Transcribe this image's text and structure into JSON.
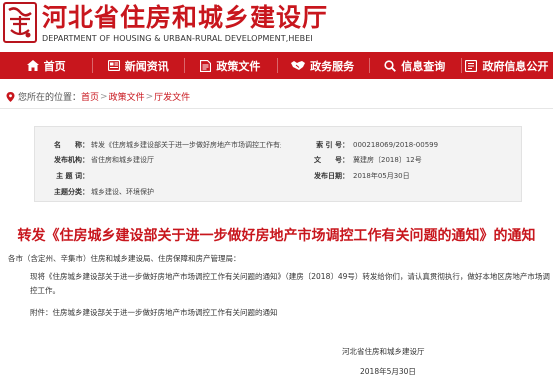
{
  "header": {
    "logo_text": "住建",
    "title": "河北省住房和城乡建设厅",
    "subtitle": "DEPARTMENT OF HOUSING & URBAN-RURAL DEVELOPMENT,HEBEI"
  },
  "nav": {
    "items": [
      {
        "label": "首页",
        "icon": "home-icon"
      },
      {
        "label": "新闻资讯",
        "icon": "news-icon"
      },
      {
        "label": "政策文件",
        "icon": "document-icon"
      },
      {
        "label": "政务服务",
        "icon": "handshake-icon"
      },
      {
        "label": "信息查询",
        "icon": "search-icon"
      },
      {
        "label": "政府信息公开",
        "icon": "info-disclosure-icon"
      }
    ]
  },
  "breadcrumb": {
    "prefix": "您所在的位置：",
    "items": [
      "首页",
      "政策文件",
      "厅发文件"
    ],
    "separator": ">"
  },
  "meta": {
    "name_label": "名　　称：",
    "name_value": "转发《住房城乡建设部关于进一步做好房地产市场调控工作有关...",
    "index_label": "索 引 号：",
    "index_value": "000218069/2018-00599",
    "issuer_label": "发布机构：",
    "issuer_value": "省住房和城乡建设厅",
    "docno_label": "文　　号：",
    "docno_value": "冀建房〔2018〕12号",
    "keywords_label": "主 题 词：",
    "keywords_value": "",
    "date_label": "发布日期：",
    "date_value": "2018年05月30日",
    "category_label": "主题分类：",
    "category_value": "城乡建设、环境保护"
  },
  "document": {
    "title": "转发《住房城乡建设部关于进一步做好房地产市场调控工作有关问题的通知》的通知",
    "salutation": "各市（含定州、辛集市）住房和城乡建设局、住房保障和房产管理局：",
    "paragraph_1": "现将《住房城乡建设部关于进一步做好房地产市场调控工作有关问题的通知》（建房〔2018〕49号）转发给你们，请认真贯彻执行，做好本地区房地产市场调",
    "paragraph_1_cont": "控工作。",
    "attachment": "附件：住房城乡建设部关于进一步做好房地产市场调控工作有关问题的通知",
    "signature": "河北省住房和城乡建设厅",
    "signed_date": "2018年5月30日"
  },
  "colors": {
    "brand_red": "#c8161d",
    "meta_bg": "#f3f3f3"
  }
}
